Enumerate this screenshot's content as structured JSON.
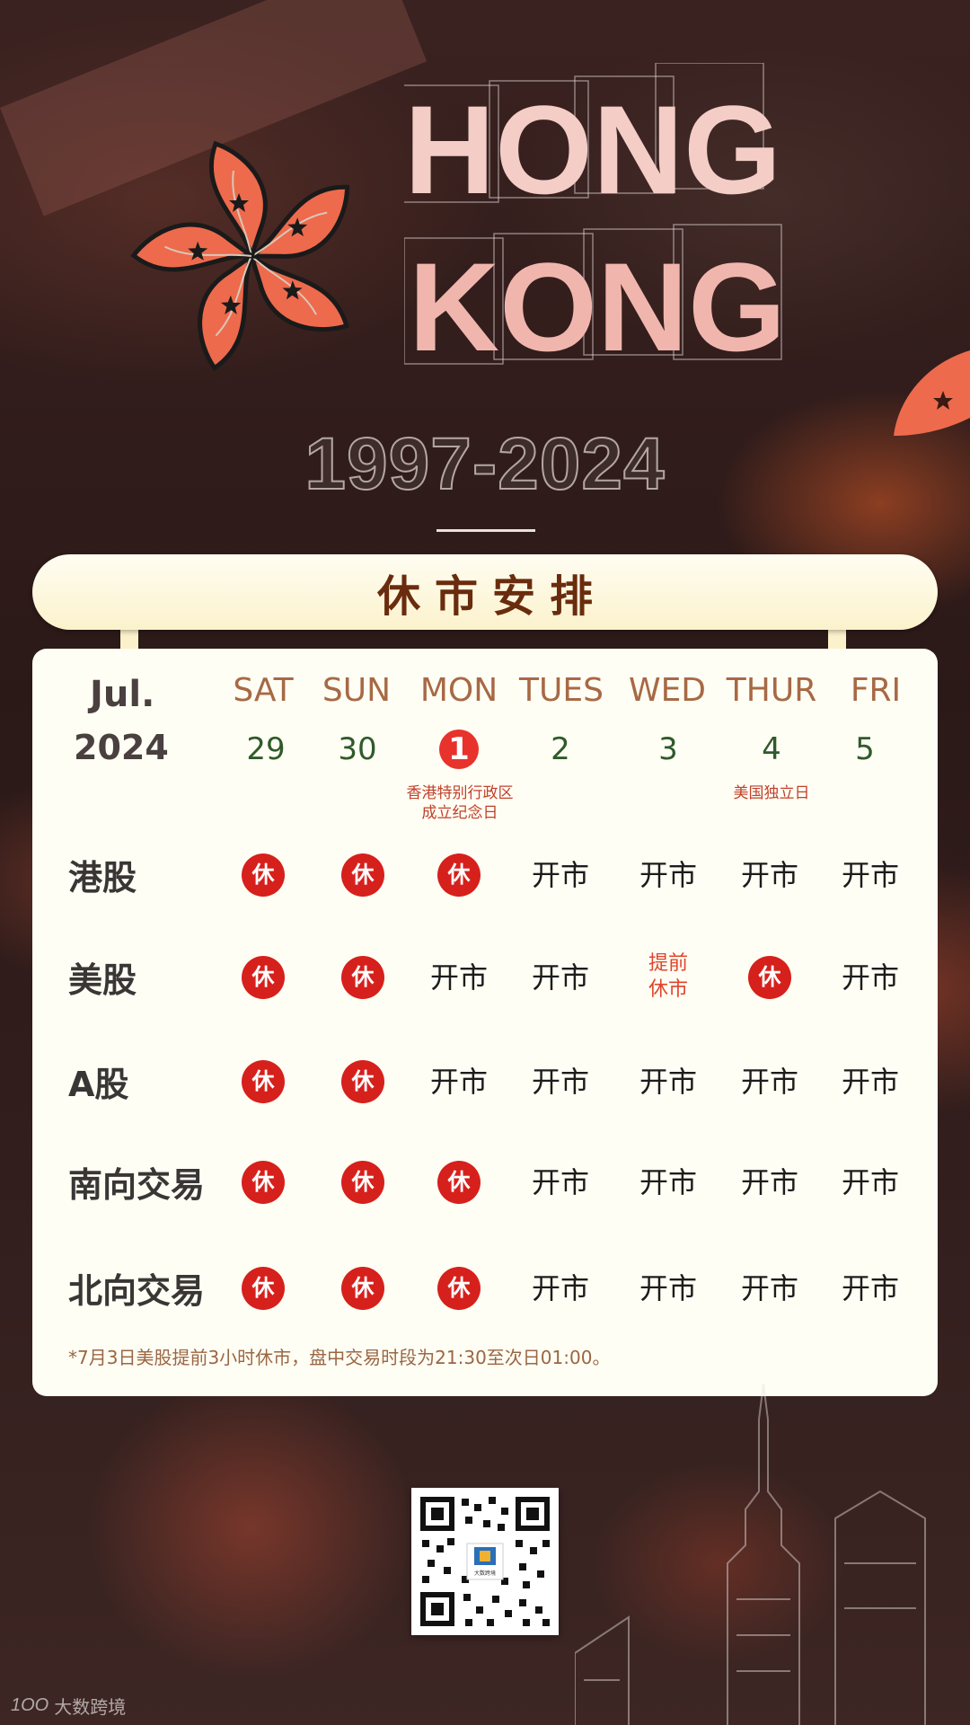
{
  "hero": {
    "word_line1": "HONG",
    "word_line2": "KONG",
    "years": "1997-2024"
  },
  "banner": {
    "title": "休市安排"
  },
  "calendar": {
    "month": "Jul.",
    "year": "2024",
    "days": [
      {
        "name": "SAT",
        "num": "29",
        "note": ""
      },
      {
        "name": "SUN",
        "num": "30",
        "note": ""
      },
      {
        "name": "MON",
        "num": "1",
        "note_line1": "香港特别行政区",
        "note_line2": "成立纪念日",
        "holiday": true
      },
      {
        "name": "TUES",
        "num": "2",
        "note": ""
      },
      {
        "name": "WED",
        "num": "3",
        "note": ""
      },
      {
        "name": "THUR",
        "num": "4",
        "note_line1": "美国独立日"
      },
      {
        "name": "FRI",
        "num": "5",
        "note": ""
      }
    ]
  },
  "labels": {
    "closed": "休",
    "open": "开市",
    "early_line1": "提前",
    "early_line2": "休市"
  },
  "markets": [
    {
      "name": "港股",
      "status": [
        "closed",
        "closed",
        "closed",
        "open",
        "open",
        "open",
        "open"
      ]
    },
    {
      "name": "美股",
      "status": [
        "closed",
        "closed",
        "open",
        "open",
        "early",
        "closed",
        "open"
      ]
    },
    {
      "name": "A股",
      "status": [
        "closed",
        "closed",
        "open",
        "open",
        "open",
        "open",
        "open"
      ]
    },
    {
      "name": "南向交易",
      "status": [
        "closed",
        "closed",
        "closed",
        "open",
        "open",
        "open",
        "open"
      ]
    },
    {
      "name": "北向交易",
      "status": [
        "closed",
        "closed",
        "closed",
        "open",
        "open",
        "open",
        "open"
      ]
    }
  ],
  "footnote": "*7月3日美股提前3小时休市，盘中交易时段为21:30至次日01:00。",
  "qr": {
    "center_text": "大数跨境"
  },
  "watermark": {
    "text": "大数跨境",
    "logo": "1OO"
  },
  "colors": {
    "accent_red": "#d6201c",
    "card_bg": "#fffef4",
    "banner_text": "#6a2c0e"
  }
}
